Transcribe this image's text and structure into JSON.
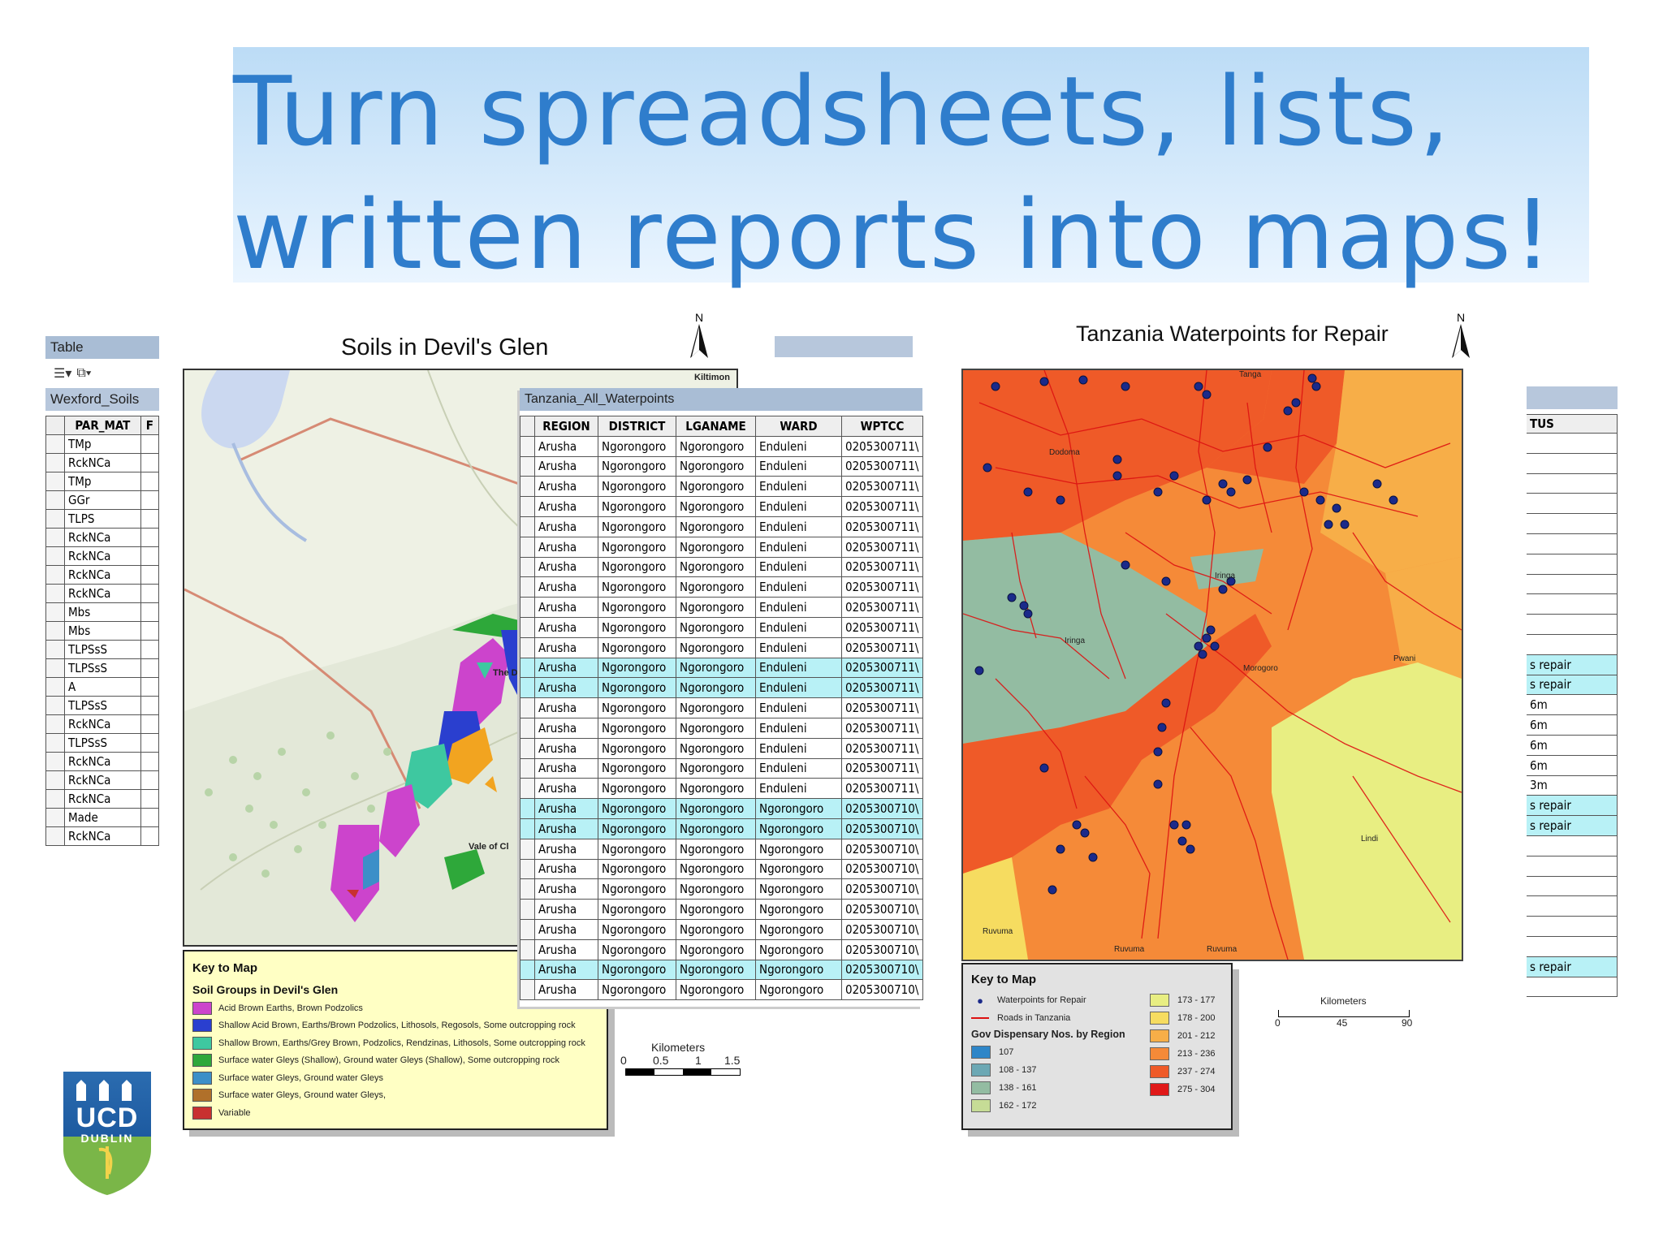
{
  "slide": {
    "title_line1": "Turn spreadsheets, lists,",
    "title_line2": "written reports into maps!"
  },
  "left_table": {
    "window_title": "Table",
    "layer_name": "Wexford_Soils",
    "column_header": "PAR_MAT",
    "column_header_partial": "F",
    "rows": [
      "TMp",
      "RckNCa",
      "TMp",
      "GGr",
      "TLPS",
      "RckNCa",
      "RckNCa",
      "RckNCa",
      "RckNCa",
      "Mbs",
      "Mbs",
      "TLPSsS",
      "TLPSsS",
      "A",
      "TLPSsS",
      "RckNCa",
      "TLPSsS",
      "RckNCa",
      "RckNCa",
      "RckNCa",
      "Made",
      "RckNCa"
    ]
  },
  "soils_map": {
    "title": "Soils in Devil's Glen",
    "north_label": "N",
    "place_labels": [
      "Kiltimon",
      "The D",
      "Vale of Cl"
    ],
    "scale_title": "Kilometers",
    "scale_ticks": [
      "0",
      "0.5",
      "1",
      "1.5"
    ],
    "key_title": "Key to Map",
    "key_subtitle": "Soil Groups in Devil's Glen",
    "legend": [
      {
        "label": "Acid Brown Earths, Brown Podzolics",
        "color": "#cc44cc"
      },
      {
        "label": "Shallow Acid Brown, Earths/Brown Podzolics, Lithosols, Regosols, Some outcropping rock",
        "color": "#2a3fcf"
      },
      {
        "label": "Shallow Brown, Earths/Grey Brown, Podzolics, Rendzinas, Lithosols, Some outcropping rock",
        "color": "#3ec8a0"
      },
      {
        "label": "Surface water Gleys (Shallow), Ground water Gleys (Shallow), Some outcropping rock",
        "color": "#2ea83a"
      },
      {
        "label": "Surface water Gleys, Ground water Gleys",
        "color": "#3c8fc8"
      },
      {
        "label": "Surface water Gleys, Ground water Gleys,",
        "color": "#b0702a"
      },
      {
        "label": "Variable",
        "color": "#c83030"
      }
    ]
  },
  "waterpoints_table": {
    "window_title": "Tanzania_All_Waterpoints",
    "columns": [
      "REGION",
      "DISTRICT",
      "LGANAME",
      "WARD",
      "WPTCC"
    ],
    "rows": [
      {
        "region": "Arusha",
        "district": "Ngorongoro",
        "lga": "Ngorongoro",
        "ward": "Enduleni",
        "wpt": "0205300711\\",
        "hl": false
      },
      {
        "region": "Arusha",
        "district": "Ngorongoro",
        "lga": "Ngorongoro",
        "ward": "Enduleni",
        "wpt": "0205300711\\",
        "hl": false
      },
      {
        "region": "Arusha",
        "district": "Ngorongoro",
        "lga": "Ngorongoro",
        "ward": "Enduleni",
        "wpt": "0205300711\\",
        "hl": false
      },
      {
        "region": "Arusha",
        "district": "Ngorongoro",
        "lga": "Ngorongoro",
        "ward": "Enduleni",
        "wpt": "0205300711\\",
        "hl": false
      },
      {
        "region": "Arusha",
        "district": "Ngorongoro",
        "lga": "Ngorongoro",
        "ward": "Enduleni",
        "wpt": "0205300711\\",
        "hl": false
      },
      {
        "region": "Arusha",
        "district": "Ngorongoro",
        "lga": "Ngorongoro",
        "ward": "Enduleni",
        "wpt": "0205300711\\",
        "hl": false
      },
      {
        "region": "Arusha",
        "district": "Ngorongoro",
        "lga": "Ngorongoro",
        "ward": "Enduleni",
        "wpt": "0205300711\\",
        "hl": false
      },
      {
        "region": "Arusha",
        "district": "Ngorongoro",
        "lga": "Ngorongoro",
        "ward": "Enduleni",
        "wpt": "0205300711\\",
        "hl": false
      },
      {
        "region": "Arusha",
        "district": "Ngorongoro",
        "lga": "Ngorongoro",
        "ward": "Enduleni",
        "wpt": "0205300711\\",
        "hl": false
      },
      {
        "region": "Arusha",
        "district": "Ngorongoro",
        "lga": "Ngorongoro",
        "ward": "Enduleni",
        "wpt": "0205300711\\",
        "hl": false
      },
      {
        "region": "Arusha",
        "district": "Ngorongoro",
        "lga": "Ngorongoro",
        "ward": "Enduleni",
        "wpt": "0205300711\\",
        "hl": false
      },
      {
        "region": "Arusha",
        "district": "Ngorongoro",
        "lga": "Ngorongoro",
        "ward": "Enduleni",
        "wpt": "0205300711\\",
        "hl": true
      },
      {
        "region": "Arusha",
        "district": "Ngorongoro",
        "lga": "Ngorongoro",
        "ward": "Enduleni",
        "wpt": "0205300711\\",
        "hl": true
      },
      {
        "region": "Arusha",
        "district": "Ngorongoro",
        "lga": "Ngorongoro",
        "ward": "Enduleni",
        "wpt": "0205300711\\",
        "hl": false
      },
      {
        "region": "Arusha",
        "district": "Ngorongoro",
        "lga": "Ngorongoro",
        "ward": "Enduleni",
        "wpt": "0205300711\\",
        "hl": false
      },
      {
        "region": "Arusha",
        "district": "Ngorongoro",
        "lga": "Ngorongoro",
        "ward": "Enduleni",
        "wpt": "0205300711\\",
        "hl": false
      },
      {
        "region": "Arusha",
        "district": "Ngorongoro",
        "lga": "Ngorongoro",
        "ward": "Enduleni",
        "wpt": "0205300711\\",
        "hl": false
      },
      {
        "region": "Arusha",
        "district": "Ngorongoro",
        "lga": "Ngorongoro",
        "ward": "Enduleni",
        "wpt": "0205300711\\",
        "hl": false
      },
      {
        "region": "Arusha",
        "district": "Ngorongoro",
        "lga": "Ngorongoro",
        "ward": "Ngorongoro",
        "wpt": "0205300710\\",
        "hl": true
      },
      {
        "region": "Arusha",
        "district": "Ngorongoro",
        "lga": "Ngorongoro",
        "ward": "Ngorongoro",
        "wpt": "0205300710\\",
        "hl": true
      },
      {
        "region": "Arusha",
        "district": "Ngorongoro",
        "lga": "Ngorongoro",
        "ward": "Ngorongoro",
        "wpt": "0205300710\\",
        "hl": false
      },
      {
        "region": "Arusha",
        "district": "Ngorongoro",
        "lga": "Ngorongoro",
        "ward": "Ngorongoro",
        "wpt": "0205300710\\",
        "hl": false
      },
      {
        "region": "Arusha",
        "district": "Ngorongoro",
        "lga": "Ngorongoro",
        "ward": "Ngorongoro",
        "wpt": "0205300710\\",
        "hl": false
      },
      {
        "region": "Arusha",
        "district": "Ngorongoro",
        "lga": "Ngorongoro",
        "ward": "Ngorongoro",
        "wpt": "0205300710\\",
        "hl": false
      },
      {
        "region": "Arusha",
        "district": "Ngorongoro",
        "lga": "Ngorongoro",
        "ward": "Ngorongoro",
        "wpt": "0205300710\\",
        "hl": false
      },
      {
        "region": "Arusha",
        "district": "Ngorongoro",
        "lga": "Ngorongoro",
        "ward": "Ngorongoro",
        "wpt": "0205300710\\",
        "hl": false
      },
      {
        "region": "Arusha",
        "district": "Ngorongoro",
        "lga": "Ngorongoro",
        "ward": "Ngorongoro",
        "wpt": "0205300710\\",
        "hl": true
      },
      {
        "region": "Arusha",
        "district": "Ngorongoro",
        "lga": "Ngorongoro",
        "ward": "Ngorongoro",
        "wpt": "0205300710\\",
        "hl": false
      }
    ]
  },
  "tanzania_map": {
    "title": "Tanzania Waterpoints for Repair",
    "north_label": "N",
    "place_labels": [
      "Tanga",
      "Dodoma",
      "Iringa",
      "Iringa",
      "Morogoro",
      "Pwani",
      "Lindi",
      "Ruvuma",
      "Ruvuma",
      "Ruvuma"
    ],
    "scale_title": "Kilometers",
    "scale_ticks": [
      "0",
      "45",
      "90"
    ],
    "key_title": "Key to Map",
    "waterpoints_label": "Waterpoints for Repair",
    "roads_label": "Roads in Tanzania",
    "choropleth_title": "Gov Dispensary Nos. by Region",
    "classes_left": [
      {
        "label": "107",
        "color": "#2e86c8"
      },
      {
        "label": "108 - 137",
        "color": "#6ca8b4"
      },
      {
        "label": "138 - 161",
        "color": "#93bca2"
      },
      {
        "label": "162 - 172",
        "color": "#c6dc96"
      }
    ],
    "classes_right": [
      {
        "label": "173 - 177",
        "color": "#e8ee82"
      },
      {
        "label": "178 - 200",
        "color": "#f6dc60"
      },
      {
        "label": "201 - 212",
        "color": "#f7ae48"
      },
      {
        "label": "213 - 236",
        "color": "#f58a38"
      },
      {
        "label": "237 - 274",
        "color": "#ef5a28"
      },
      {
        "label": "275 - 304",
        "color": "#e01818"
      }
    ]
  },
  "right_table": {
    "column_header": "TUS",
    "rows": [
      "",
      "",
      "",
      "",
      "",
      "",
      "",
      "",
      "",
      "",
      "",
      "s repair",
      "s repair",
      "6m",
      "6m",
      "6m",
      "6m",
      "3m",
      "s repair",
      "s repair",
      "",
      "",
      "",
      "",
      "",
      "",
      "s repair",
      ""
    ],
    "highlighted": [
      false,
      false,
      false,
      false,
      false,
      false,
      false,
      false,
      false,
      false,
      false,
      true,
      true,
      false,
      false,
      false,
      false,
      false,
      true,
      true,
      false,
      false,
      false,
      false,
      false,
      false,
      true,
      false
    ]
  },
  "logo": {
    "line1": "UCD",
    "line2": "DUBLIN"
  }
}
